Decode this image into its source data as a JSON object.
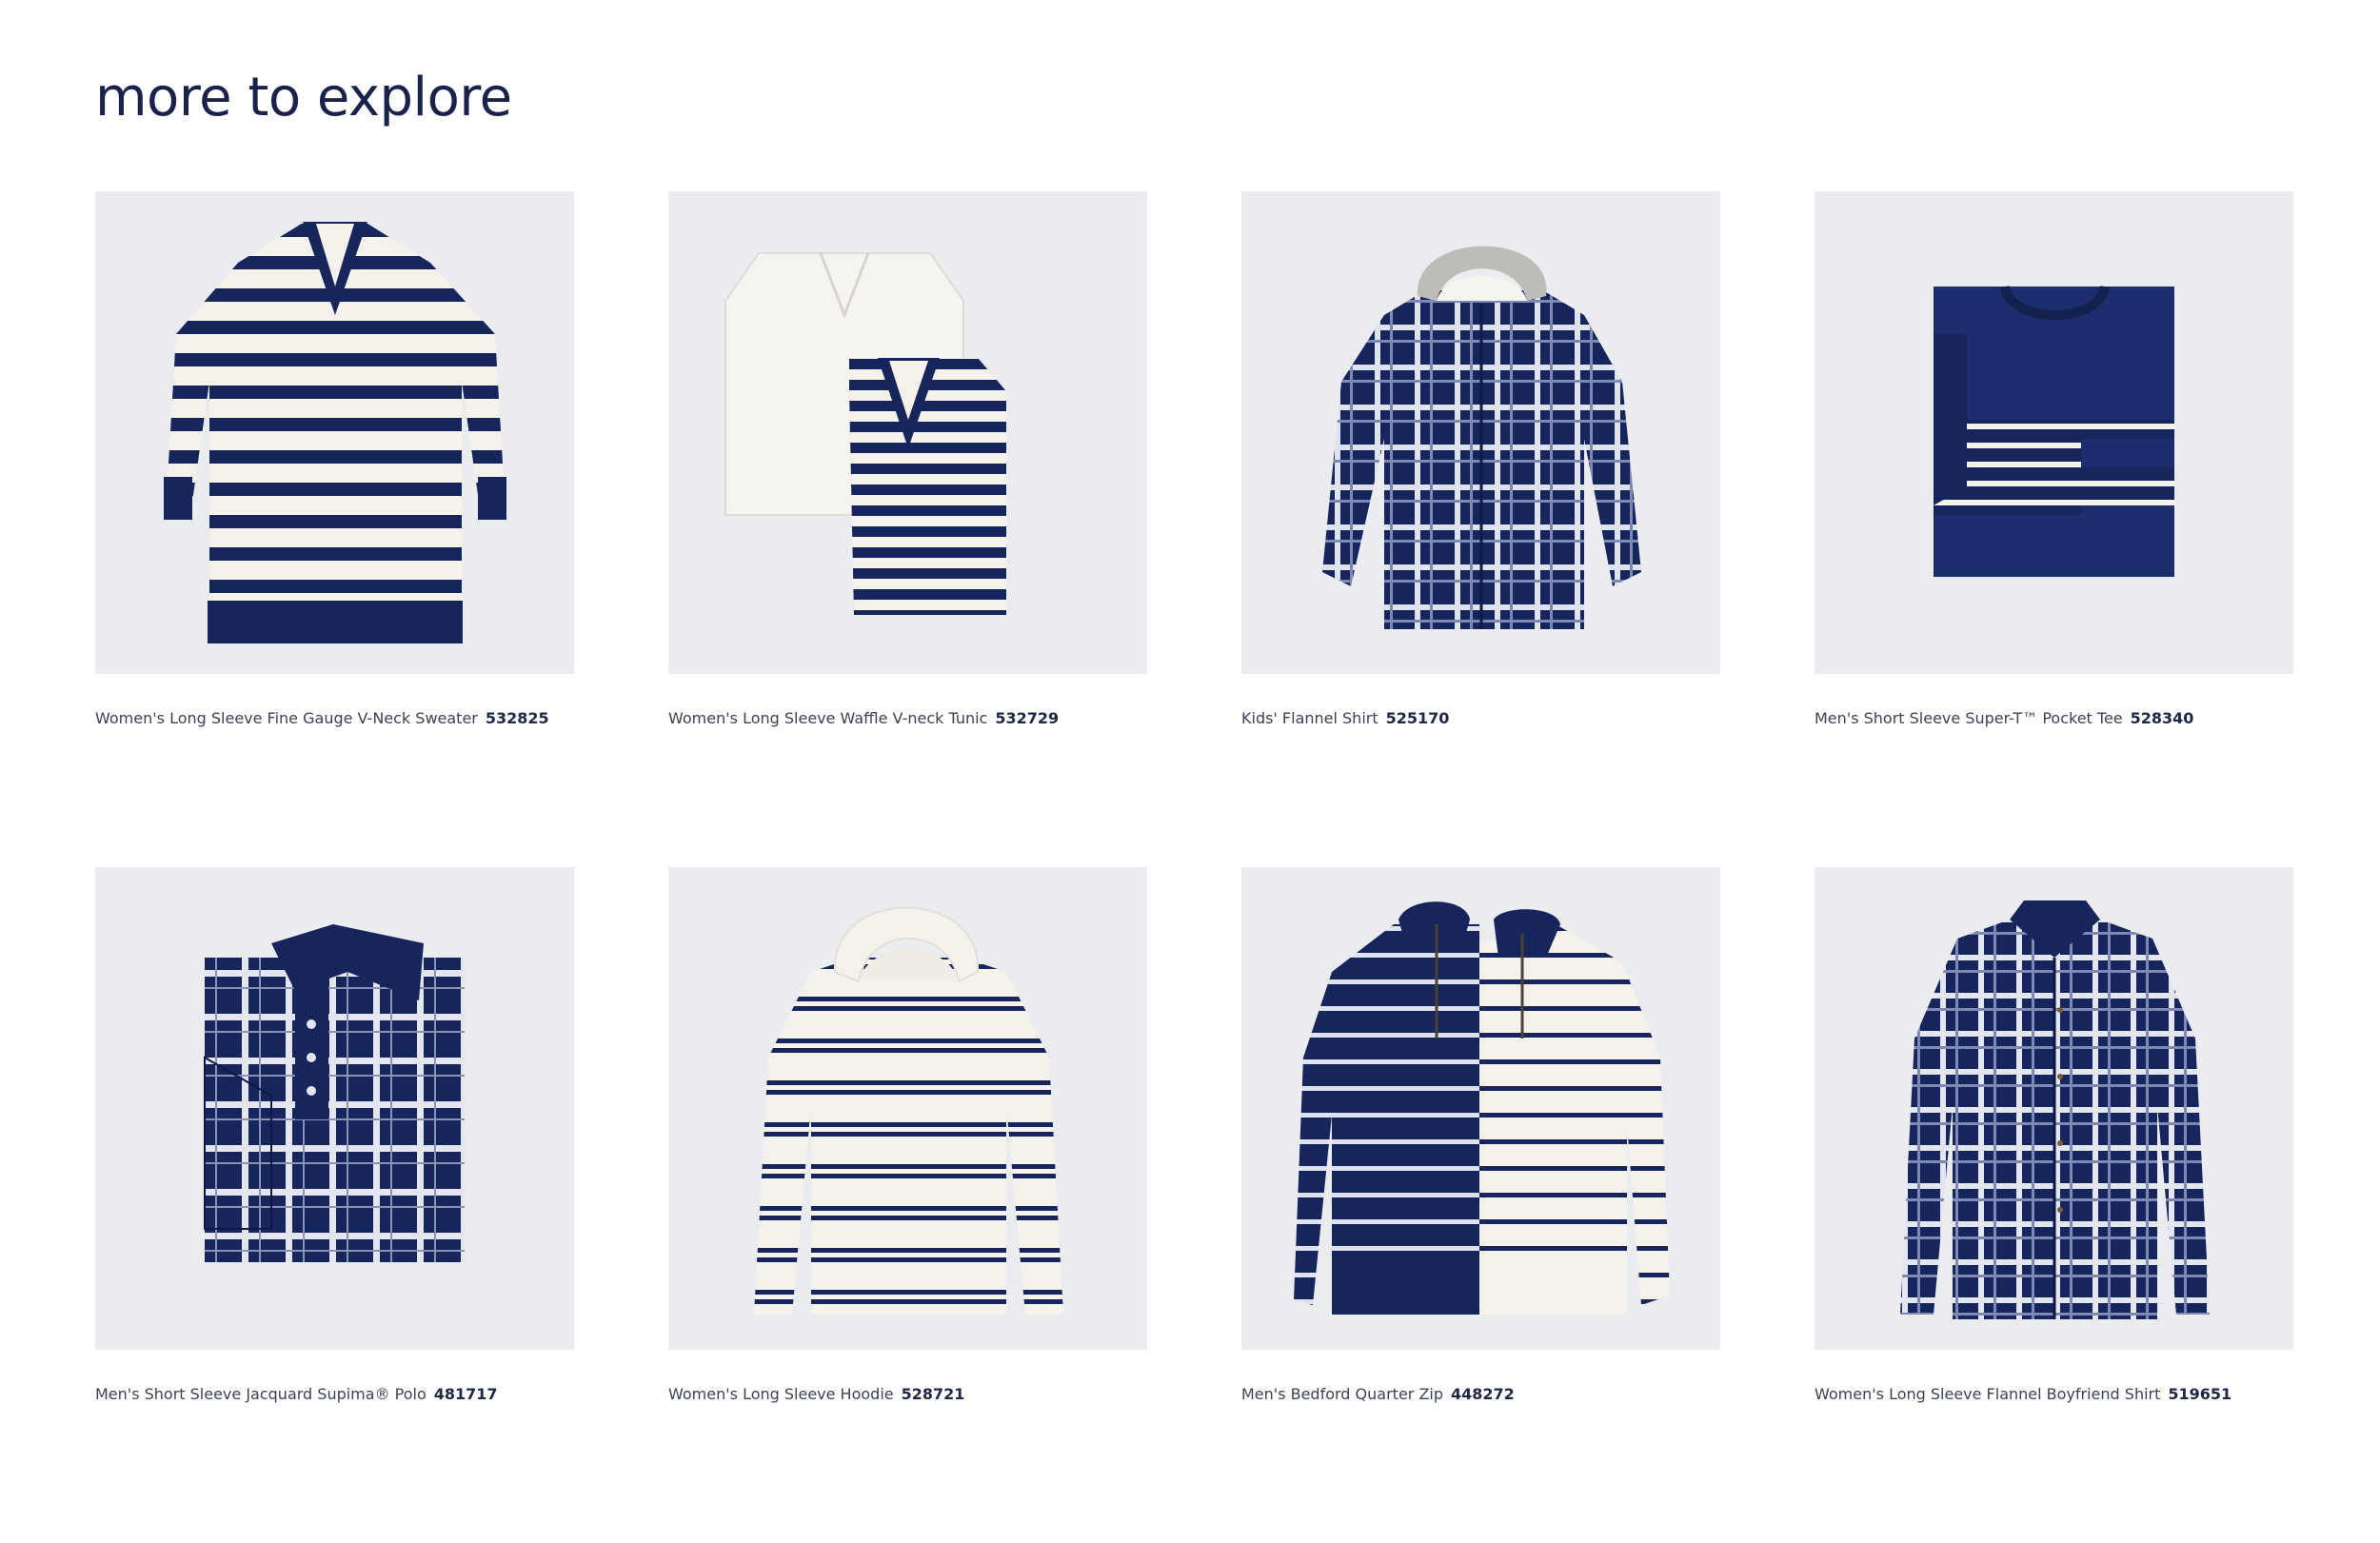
{
  "header": {
    "title": "more to explore"
  },
  "colors": {
    "navy": "#16255b",
    "cream": "#f4f2ea",
    "image_bg": "#ebecf0",
    "text": "#3c4258"
  },
  "products": [
    {
      "name": "Women's Long Sleeve Fine Gauge V-Neck Sweater",
      "sku": "532825",
      "icon": "striped-vneck-sweater"
    },
    {
      "name": "Women's Long Sleeve Waffle V-neck Tunic",
      "sku": "532729",
      "icon": "folded-vneck-tunics"
    },
    {
      "name": "Kids' Flannel Shirt",
      "sku": "525170",
      "icon": "hooded-flannel-shirt"
    },
    {
      "name": "Men's Short Sleeve Super-T™ Pocket Tee",
      "sku": "528340",
      "icon": "folded-pocket-tee"
    },
    {
      "name": "Men's Short Sleeve Jacquard Supima® Polo",
      "sku": "481717",
      "icon": "folded-plaid-polo"
    },
    {
      "name": "Women's Long Sleeve Hoodie",
      "sku": "528721",
      "icon": "striped-hoodie"
    },
    {
      "name": "Men's Bedford Quarter Zip",
      "sku": "448272",
      "icon": "striped-quarter-zips"
    },
    {
      "name": "Women's Long Sleeve Flannel Boyfriend Shirt",
      "sku": "519651",
      "icon": "plaid-boyfriend-shirt"
    }
  ]
}
